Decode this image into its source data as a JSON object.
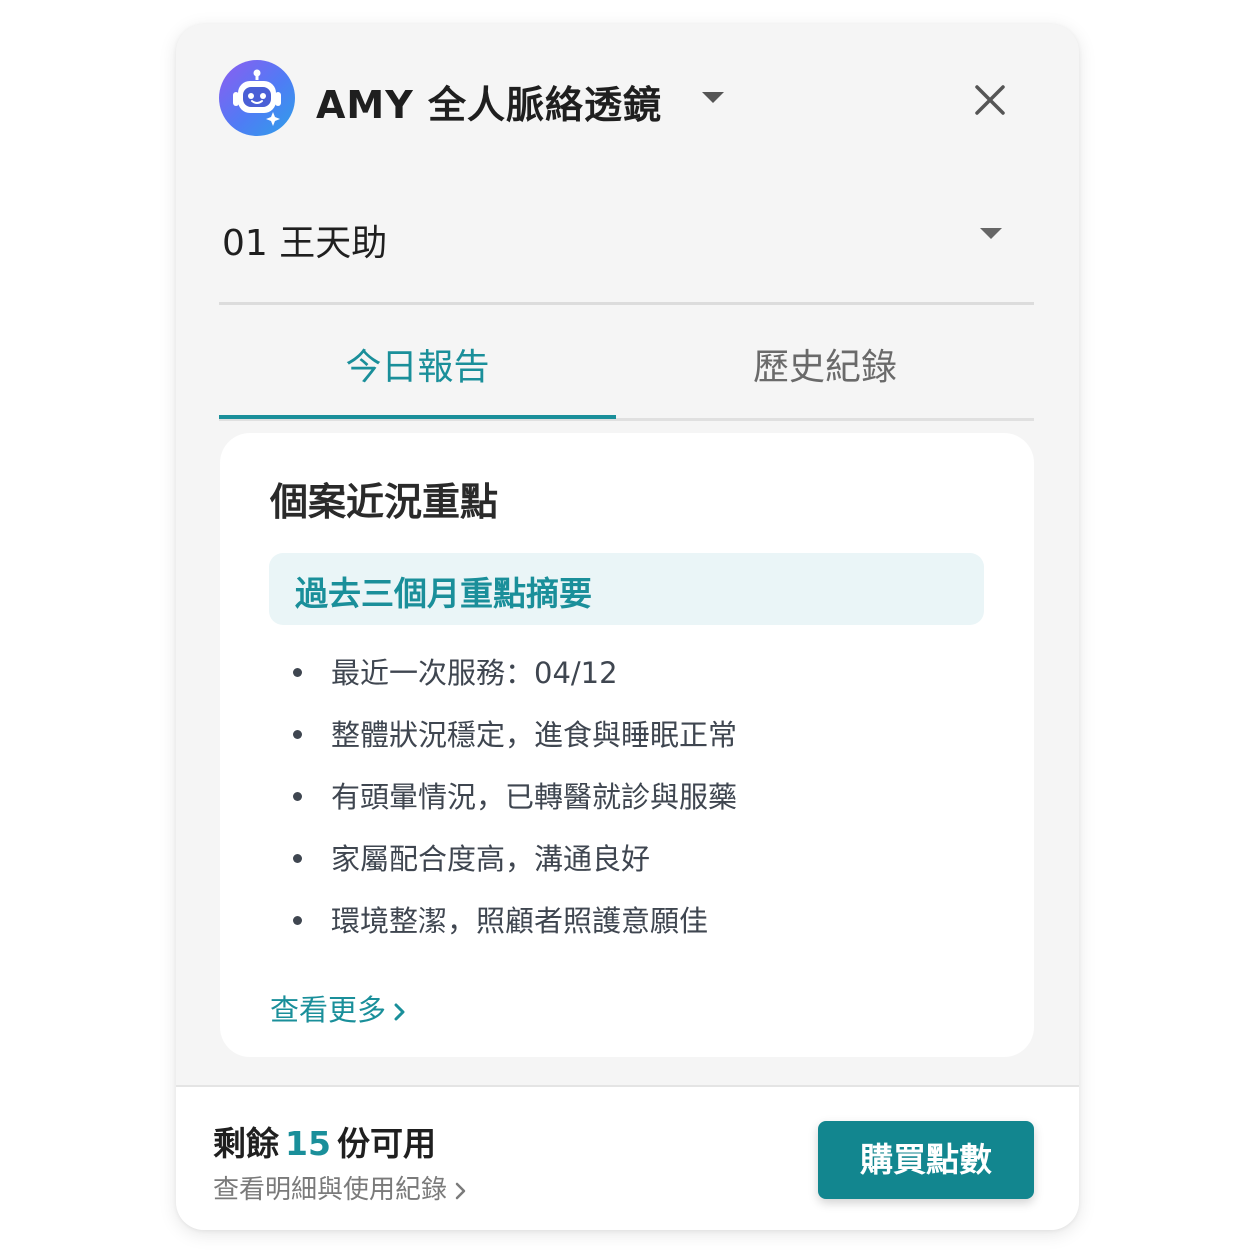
{
  "header": {
    "app_title": "AMY 全人脈絡透鏡",
    "avatar_icon": "robot-icon",
    "close_icon": "close-icon"
  },
  "case_selector": {
    "selected": "01 王天助"
  },
  "tabs": [
    {
      "label": "今日報告",
      "active": true
    },
    {
      "label": "歷史紀錄",
      "active": false
    }
  ],
  "card": {
    "title": "個案近況重點",
    "summary_label": "過去三個月重點摘要",
    "bullets": [
      "最近一次服務：04/12",
      "整體狀況穩定，進食與睡眠正常",
      "有頭暈情況，已轉醫就診與服藥",
      "家屬配合度高，溝通良好",
      "環境整潔，照顧者照護意願佳"
    ],
    "more_link": "查看更多"
  },
  "footer": {
    "remain_prefix": "剩餘",
    "remain_count": "15",
    "remain_suffix": "份可用",
    "detail_link": "查看明細與使用紀錄",
    "buy_button": "購買點數"
  },
  "colors": {
    "accent": "#1a8f9a",
    "button": "#12868f",
    "summary_bg": "#eaf5f7",
    "panel_bg": "#f5f5f5"
  }
}
